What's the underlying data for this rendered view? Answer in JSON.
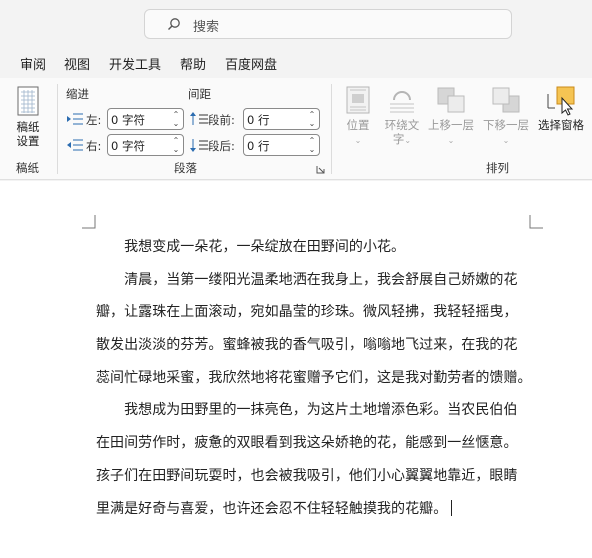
{
  "search": {
    "placeholder": "搜索"
  },
  "menu": {
    "tabs": [
      "审阅",
      "视图",
      "开发工具",
      "帮助",
      "百度网盘"
    ]
  },
  "ribbon": {
    "manuscript": {
      "button_line1": "稿纸",
      "button_line2": "设置",
      "group_label": "稿纸"
    },
    "paragraph": {
      "indent_title": "缩进",
      "spacing_title": "间距",
      "left_label": "左:",
      "right_label": "右:",
      "before_label": "段前:",
      "after_label": "段后:",
      "left_value": "0 字符",
      "right_value": "0 字符",
      "before_value": "0 行",
      "after_value": "0 行",
      "group_label": "段落"
    },
    "arrange": {
      "position": "位置",
      "wrap_line1": "环绕文",
      "wrap_line2": "字",
      "bring_forward": "上移一层",
      "send_backward": "下移一层",
      "selection_pane": "选择窗格",
      "group_label": "排列"
    }
  },
  "document": {
    "lines": [
      "　　我想变成一朵花，一朵绽放在田野间的小花。",
      "　　清晨，当第一缕阳光温柔地洒在我身上，我会舒展自己娇嫩的花",
      "瓣，让露珠在上面滚动，宛如晶莹的珍珠。微风轻拂，我轻轻摇曳，",
      "散发出淡淡的芬芳。蜜蜂被我的香气吸引，嗡嗡地飞过来，在我的花",
      "蕊间忙碌地采蜜，我欣然地将花蜜赠予它们，这是我对勤劳者的馈赠。",
      "　　我想成为田野里的一抹亮色，为这片土地增添色彩。当农民伯伯",
      "在田间劳作时，疲惫的双眼看到我这朵娇艳的花，能感到一丝惬意。",
      "孩子们在田野间玩耍时，也会被我吸引，他们小心翼翼地靠近，眼睛",
      "里满是好奇与喜爱，也许还会忍不住轻轻触摸我的花瓣。"
    ]
  },
  "colors": {
    "accent_yellow": "#f5c453",
    "ribbon_bg": "#fafafa",
    "chrome_bg": "#f3f3f3"
  }
}
